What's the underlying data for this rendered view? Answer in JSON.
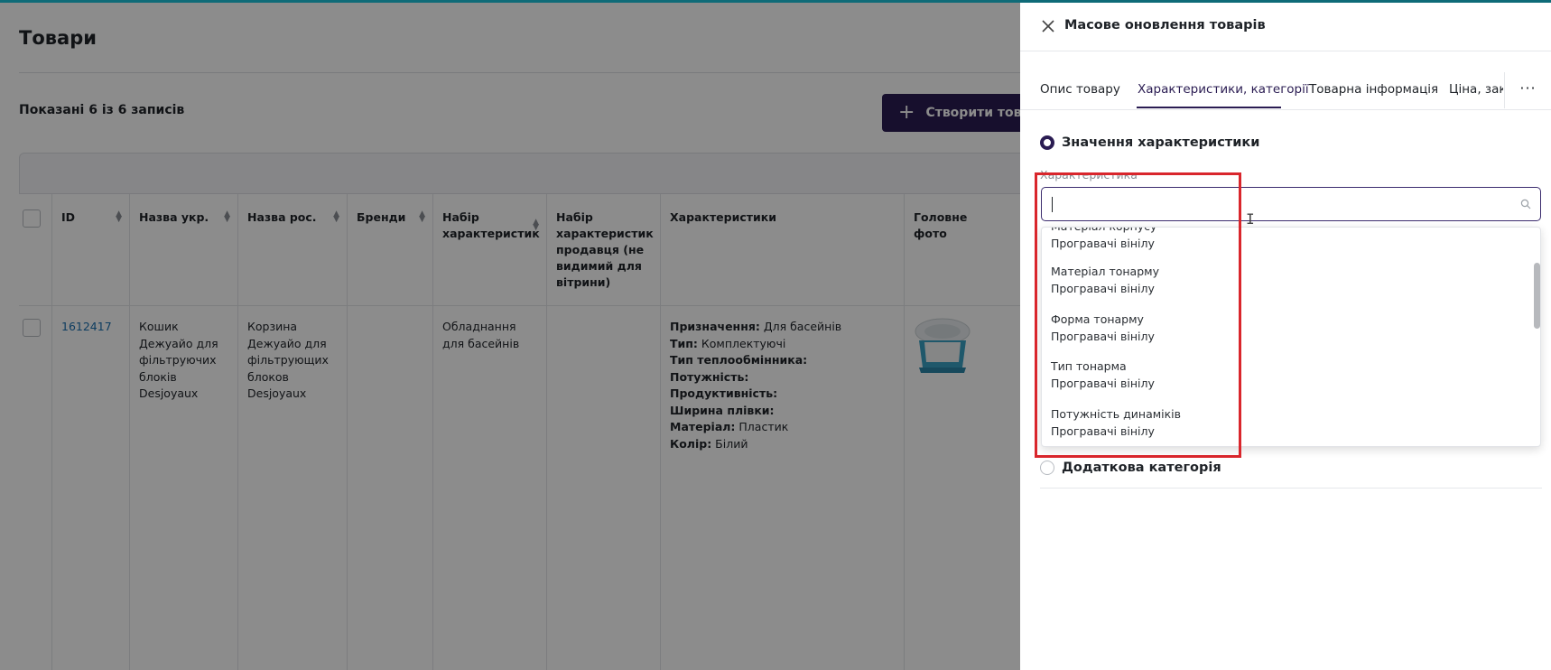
{
  "page": {
    "title": "Товари",
    "records_count": "Показані 6 із 6 записів",
    "create_button_label": "Створити товар"
  },
  "table": {
    "headers": {
      "id": "ID",
      "name_ukr": "Назва укр.",
      "name_rus": "Назва рос.",
      "brands": "Бренди",
      "feature_set": "Набір характеристик",
      "seller_feature_set": "Набір характеристик продавця (не видимий для вітрини)",
      "features": "Характеристики",
      "main_photo": "Головне фото"
    },
    "row": {
      "id": "1612417",
      "name_ukr": "Кошик Дежуайо для фільтруючих блоків Desjoyaux",
      "name_rus": "Корзина Дежуайо для фільтрующих блоков Desjoyaux",
      "brands": "",
      "feature_set": "Обладнання для басейнів",
      "seller_feature_set": "",
      "features": [
        {
          "name": "Призначення:",
          "value": " Для басейнів"
        },
        {
          "name": "Тип:",
          "value": " Комплектуючі"
        },
        {
          "name": "Тип теплообмінника:",
          "value": ""
        },
        {
          "name": "Потужність:",
          "value": ""
        },
        {
          "name": "Продуктивність:",
          "value": ""
        },
        {
          "name": "Ширина плівки:",
          "value": ""
        },
        {
          "name": "Матеріал:",
          "value": " Пластик"
        },
        {
          "name": "Колір:",
          "value": " Білий"
        }
      ]
    }
  },
  "drawer": {
    "title": "Масове оновлення товарів",
    "tabs": [
      {
        "label": "Опис товару"
      },
      {
        "label": "Характеристики, категорії"
      },
      {
        "label": "Товарна інформація"
      },
      {
        "label": "Ціна, закупівля"
      }
    ],
    "tabs_more": "···",
    "radio_feature_value": "Значення характеристики",
    "field_label": "Характеристика",
    "search_value": "",
    "dropdown_items": [
      {
        "name": "Матеріал корпусу",
        "group": "Програвачі вінілу"
      },
      {
        "name": "Матеріал тонарму",
        "group": "Програвачі вінілу"
      },
      {
        "name": "Форма тонарму",
        "group": "Програвачі вінілу"
      },
      {
        "name": "Тип тонарма",
        "group": "Програвачі вінілу"
      },
      {
        "name": "Потужність динаміків",
        "group": "Програвачі вінілу"
      }
    ],
    "radio_additional_category": "Додаткова категорія"
  },
  "colors": {
    "accent": "#2a1c52",
    "link": "#1a6fb0",
    "highlight": "#d9262c",
    "top_bar": "#0f6b78"
  }
}
